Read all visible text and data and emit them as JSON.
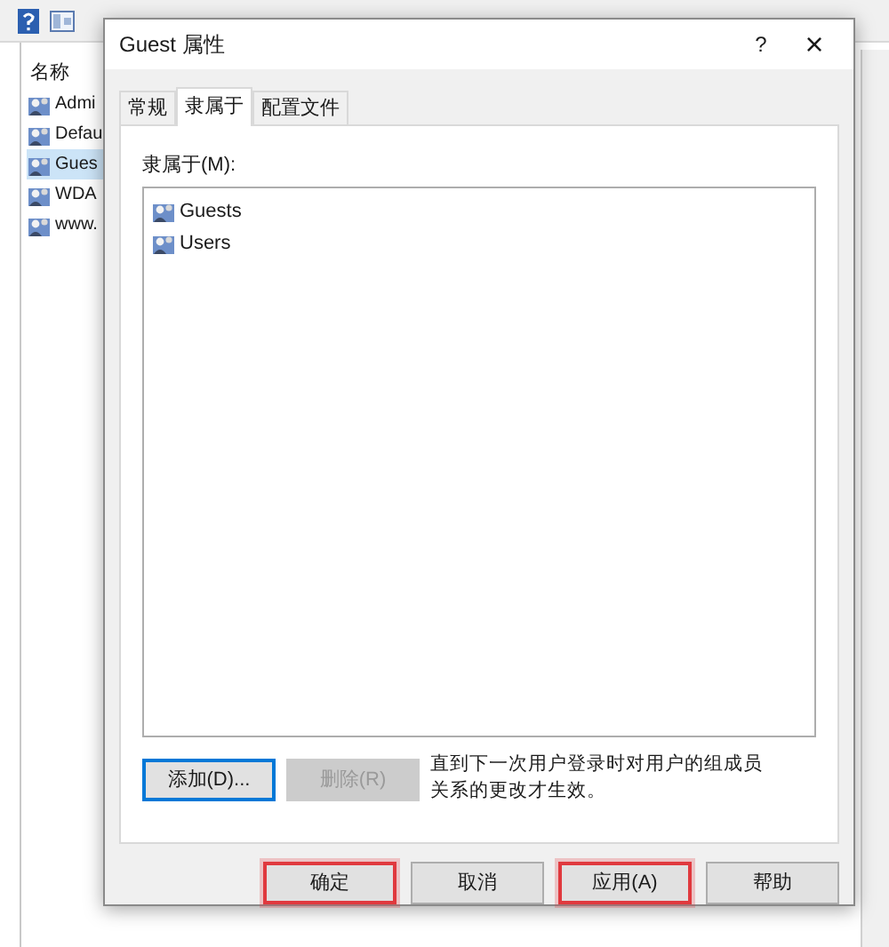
{
  "background_window": {
    "column_header": "名称",
    "items": [
      {
        "label": "Admi",
        "selected": false
      },
      {
        "label": "Defau",
        "selected": false
      },
      {
        "label": "Gues",
        "selected": true
      },
      {
        "label": "WDA",
        "selected": false
      },
      {
        "label": "www.",
        "selected": false
      }
    ]
  },
  "dialog": {
    "title": "Guest 属性",
    "help_glyph": "?",
    "close_glyph": "×",
    "tabs": [
      {
        "label": "常规",
        "selected": false
      },
      {
        "label": "隶属于",
        "selected": true
      },
      {
        "label": "配置文件",
        "selected": false
      }
    ],
    "member_of_label": "隶属于(M):",
    "groups": [
      "Guests",
      "Users"
    ],
    "actions": [
      {
        "label": "添加(D)...",
        "disabled": false,
        "focused": true
      },
      {
        "label": "删除(R)",
        "disabled": true,
        "focused": false
      }
    ],
    "note": "直到下一次用户登录时对用户的组成员关系的更改才生效。",
    "buttons": [
      {
        "label": "确定",
        "highlighted": true
      },
      {
        "label": "取消",
        "highlighted": false
      },
      {
        "label": "应用(A)",
        "highlighted": true
      },
      {
        "label": "帮助",
        "highlighted": false
      }
    ]
  }
}
